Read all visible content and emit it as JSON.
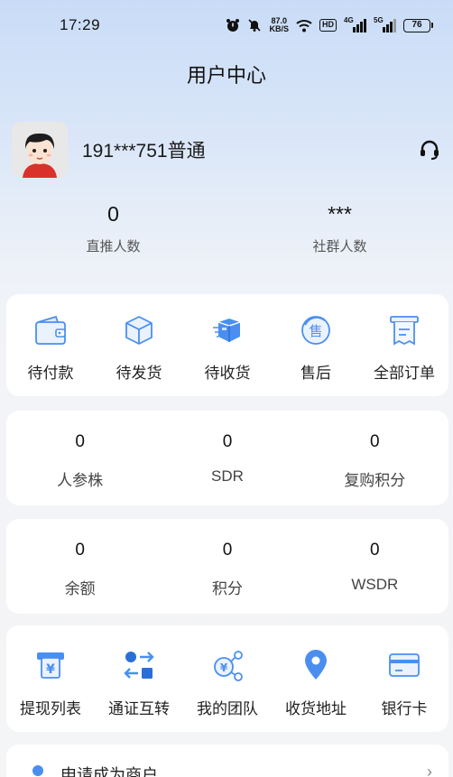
{
  "status_bar": {
    "time": "17:29",
    "net_speed_value": "87.0",
    "net_speed_unit": "KB/S",
    "hd_label": "HD",
    "signal1_label": "4G",
    "signal2_label": "5G",
    "battery": "76"
  },
  "header": {
    "title": "用户中心"
  },
  "profile": {
    "name": "191***751普通"
  },
  "stats": [
    {
      "value": "0",
      "label": "直推人数"
    },
    {
      "value": "***",
      "label": "社群人数"
    }
  ],
  "orders": [
    {
      "label": "待付款",
      "icon": "wallet-icon"
    },
    {
      "label": "待发货",
      "icon": "package-icon"
    },
    {
      "label": "待收货",
      "icon": "delivery-box-icon"
    },
    {
      "label": "售后",
      "icon": "after-sale-icon"
    },
    {
      "label": "全部订单",
      "icon": "receipt-icon"
    }
  ],
  "assets_row1": [
    {
      "value": "0",
      "label": "人参株"
    },
    {
      "value": "0",
      "label": "SDR"
    },
    {
      "value": "0",
      "label": "复购积分"
    }
  ],
  "assets_row2": [
    {
      "value": "0",
      "label": "余额"
    },
    {
      "value": "0",
      "label": "积分"
    },
    {
      "value": "0",
      "label": "WSDR"
    }
  ],
  "tools": [
    {
      "label": "提现列表",
      "icon": "withdraw-icon"
    },
    {
      "label": "通证互转",
      "icon": "transfer-icon"
    },
    {
      "label": "我的团队",
      "icon": "team-icon"
    },
    {
      "label": "收货地址",
      "icon": "location-pin-icon"
    },
    {
      "label": "银行卡",
      "icon": "bank-card-icon"
    }
  ],
  "merchant": {
    "label": "申请成为商户",
    "icon": "merchant-icon"
  },
  "colors": {
    "accent": "#4a8ff0",
    "dark_accent": "#2b6fd6"
  }
}
